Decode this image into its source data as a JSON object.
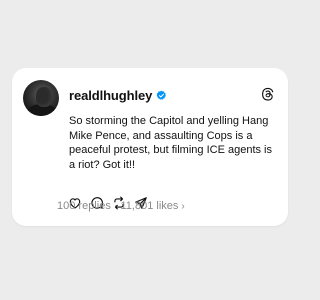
{
  "post": {
    "username": "realdlhughley",
    "text": "So storming the Capitol and yelling Hang Mike Pence, and assaulting Cops is a peaceful protest, but filming ICE agents is a riot? Got it!!",
    "replies": "100 replies",
    "separator": "·",
    "likes": "11,801 likes",
    "chevron": "›"
  },
  "icons": {
    "verified": "verified-badge-icon",
    "app_logo": "threads-logo-icon",
    "like": "heart-icon",
    "reply": "comment-icon",
    "repost": "repost-icon",
    "share": "share-icon"
  },
  "colors": {
    "background": "#ececec",
    "card": "#ffffff",
    "text": "#111111",
    "muted": "#8a8a8a",
    "verified": "#0095f6"
  }
}
